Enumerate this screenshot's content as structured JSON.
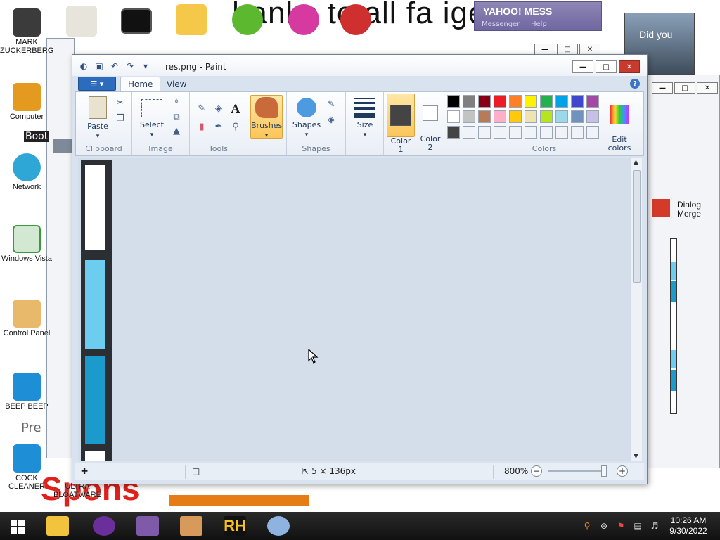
{
  "desktop": {
    "wallpaper_text": "hanks to all fa          igeons",
    "wallpaper_red_text": "Spons",
    "icons": [
      {
        "label": "MARK ZUCKERBERG",
        "icon": "person-icon"
      },
      {
        "label": "Computer",
        "icon": "computer-icon"
      },
      {
        "label": "Network",
        "icon": "network-icon"
      },
      {
        "label": "Windows Vista",
        "icon": "recycle-bin-icon"
      },
      {
        "label": "Control Panel",
        "icon": "control-panel-icon"
      },
      {
        "label": "BEEP BEEP",
        "icon": "app-icon"
      },
      {
        "label": "COCK CLEANER",
        "icon": "app-icon"
      },
      {
        "label": "ULTRA BLOATWARE",
        "icon": "app-icon"
      }
    ],
    "yahoo_window": {
      "title": "YAHOO! MESS",
      "menu": [
        "Messenger",
        "Help"
      ]
    },
    "photo_caption": "Did you",
    "bg_partial_text": [
      "Boot",
      "Pre"
    ],
    "dialog_merge_label": "Dialog Merge"
  },
  "paint": {
    "title": "res.png - Paint",
    "tabs": {
      "home": "Home",
      "view": "View"
    },
    "ribbon": {
      "clipboard": {
        "paste": "Paste",
        "label": "Clipboard"
      },
      "image": {
        "select": "Select",
        "label": "Image"
      },
      "tools": {
        "label": "Tools"
      },
      "brushes": "Brushes",
      "shapes": {
        "button": "Shapes",
        "label": "Shapes"
      },
      "size": "Size",
      "color1": "Color\n1",
      "color2": "Color\n2",
      "colors_label": "Colors",
      "edit_colors": "Edit\ncolors"
    },
    "palette": [
      [
        "#000000",
        "#7f7f7f",
        "#880015",
        "#ed1c24",
        "#ff7f27",
        "#fff200",
        "#22b14c",
        "#00a2e8",
        "#3f48cc",
        "#a349a4"
      ],
      [
        "#ffffff",
        "#c3c3c3",
        "#b97a57",
        "#ffaec9",
        "#ffc90e",
        "#efe4b0",
        "#b5e61d",
        "#99d9ea",
        "#7092be",
        "#c8bfe7"
      ],
      [
        "#444444",
        "#f0f3f7",
        "#f0f3f7",
        "#f0f3f7",
        "#f0f3f7",
        "#f0f3f7",
        "#f0f3f7",
        "#f0f3f7",
        "#f0f3f7",
        "#f0f3f7"
      ]
    ],
    "color1_value": "#444444",
    "color2_value": "#ffffff",
    "image_segments": [
      "#ffffff",
      "#6ccdee",
      "#1b9bcb",
      "#ffffff"
    ],
    "status": {
      "dimensions": "5 × 136px",
      "zoom": "800%",
      "zoom_level": 1.0
    }
  },
  "taskbar": {
    "time": "10:26 AM",
    "date": "9/30/2022",
    "apps": [
      "file-explorer-icon",
      "yahoo-messenger-icon",
      "visual-studio-icon",
      "app-icon",
      "rh-app-icon",
      "paint-icon"
    ]
  }
}
